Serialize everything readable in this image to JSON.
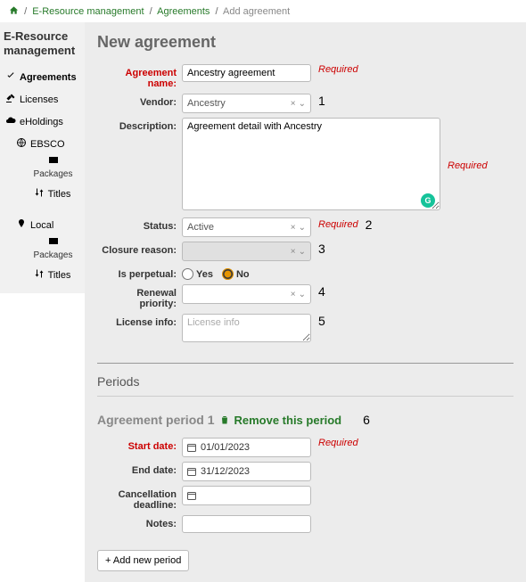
{
  "breadcrumb": {
    "root": "E-Resource management",
    "mid": "Agreements",
    "current": "Add agreement"
  },
  "sidebar": {
    "title": "E-Resource management",
    "agreements": "Agreements",
    "licenses": "Licenses",
    "eholdings": "eHoldings",
    "ebsco": "EBSCO",
    "packages": "Packages",
    "titles": "Titles",
    "local": "Local"
  },
  "main": {
    "title": "New agreement"
  },
  "labels": {
    "agreement_name": "Agreement name:",
    "vendor": "Vendor:",
    "description": "Description:",
    "status": "Status:",
    "closure_reason": "Closure reason:",
    "is_perpetual": "Is perpetual:",
    "renewal_priority": "Renewal priority:",
    "license_info": "License info:",
    "required": "Required",
    "yes": "Yes",
    "no": "No"
  },
  "values": {
    "agreement_name": "Ancestry agreement",
    "vendor": "Ancestry",
    "description": "Agreement detail with Ancestry",
    "status": "Active",
    "license_info_placeholder": "License info"
  },
  "annotations": {
    "a1": "1",
    "a2": "2",
    "a3": "3",
    "a4": "4",
    "a5": "5",
    "a6": "6"
  },
  "periods": {
    "section": "Periods",
    "title": "Agreement period 1",
    "remove": "Remove this period",
    "start_date_label": "Start date:",
    "end_date_label": "End date:",
    "cancel_label": "Cancellation deadline:",
    "notes_label": "Notes:",
    "start_date": "01/01/2023",
    "end_date": "31/12/2023",
    "add_button": "+ Add new period"
  }
}
